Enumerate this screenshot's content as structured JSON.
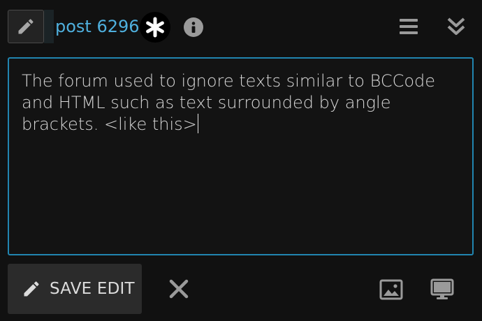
{
  "header": {
    "post_label": "post 6296",
    "icons": {
      "edit": "pencil-icon",
      "badge": "asterisk-icon",
      "info": "info-icon",
      "menu": "hamburger-menu-icon",
      "collapse": "double-chevron-down-icon"
    }
  },
  "editor": {
    "text": "The forum used to ignore texts similar to BCCode and HTML such as text surrounded by angle brackets. <like this>"
  },
  "footer": {
    "save_label": "SAVE EDIT",
    "icons": {
      "save": "pencil-icon",
      "cancel": "close-icon",
      "image": "image-icon",
      "preview": "desktop-preview-icon"
    }
  },
  "colors": {
    "background": "#111111",
    "accent": "#4fb0de",
    "editor_border": "#2185b0",
    "button_bg": "#2b2b2b"
  }
}
